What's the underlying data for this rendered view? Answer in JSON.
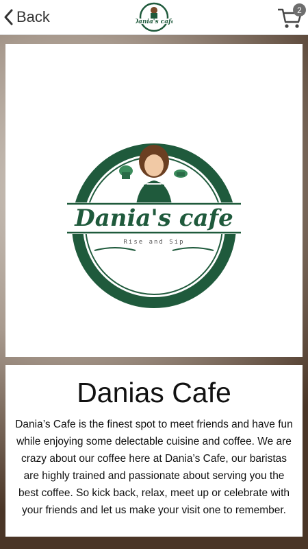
{
  "topbar": {
    "back_label": "Back",
    "cart_count": "2"
  },
  "logo": {
    "name": "Dania's cafe",
    "tagline": "Rise and Sip",
    "brand_color": "#1f5a3c"
  },
  "info": {
    "title": "Danias Cafe",
    "description": "Dania’s Cafe is the finest spot to meet friends and have fun while enjoying some delectable cuisine and coffee. We are crazy about our coffee here at Dania’s Cafe, our baristas are highly trained and passionate about serving you the best coffee. So kick back, relax, meet up or celebrate with your friends and let us make your visit one to remember."
  },
  "icons": {
    "back": "chevron-left-icon",
    "cart": "cart-icon"
  }
}
